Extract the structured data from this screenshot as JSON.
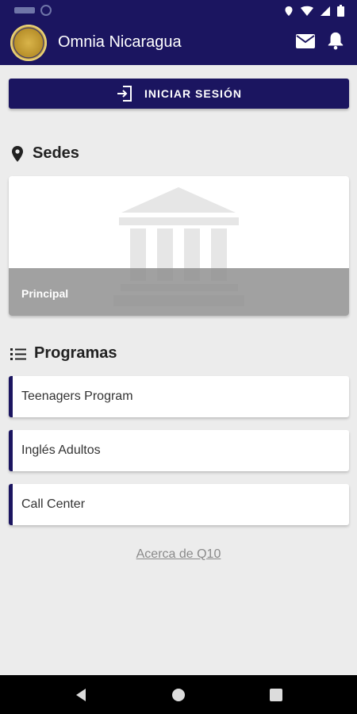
{
  "app": {
    "title": "Omnia Nicaragua",
    "brand_color": "#1b1560"
  },
  "header": {
    "icons": [
      "mail-icon",
      "bell-icon"
    ]
  },
  "login": {
    "label": "INICIAR SESIÓN",
    "icon": "login-icon"
  },
  "sedes": {
    "title": "Sedes",
    "icon": "location-pin-icon",
    "items": [
      {
        "label": "Principal"
      }
    ]
  },
  "programas": {
    "title": "Programas",
    "icon": "list-icon",
    "items": [
      {
        "label": "Teenagers Program"
      },
      {
        "label": "Inglés Adultos"
      },
      {
        "label": "Call Center"
      }
    ]
  },
  "footer": {
    "about_label": "Acerca de Q10"
  },
  "system_nav": {
    "icons": [
      "back-icon",
      "home-icon",
      "recents-icon"
    ]
  }
}
